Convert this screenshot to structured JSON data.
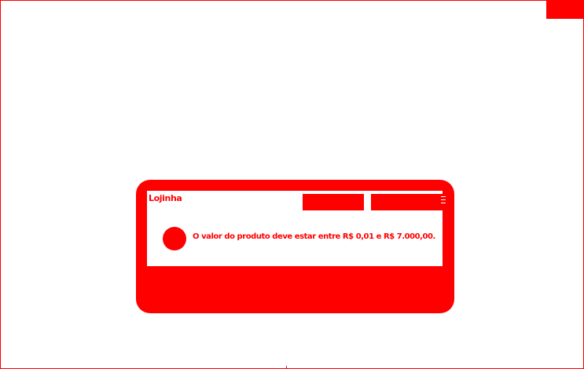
{
  "dialog": {
    "title": "Lojinha",
    "message": "O valor do produto deve estar entre R$ 0,01 e R$ 7.000,00.",
    "icon": "error-icon"
  },
  "colors": {
    "accent": "#ff0000",
    "background": "#ffffff"
  }
}
